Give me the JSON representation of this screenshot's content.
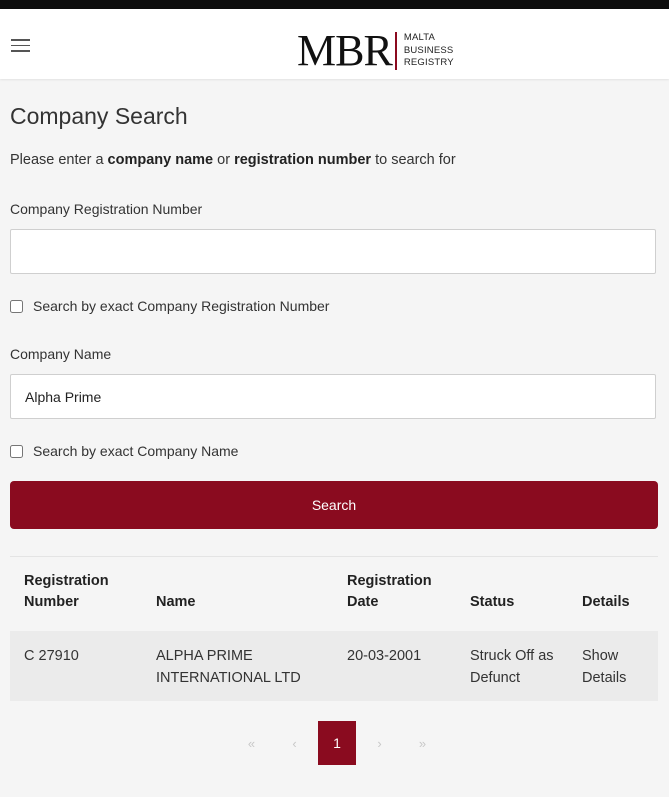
{
  "header": {
    "logo_mark": "MBR",
    "logo_lines": [
      "MALTA",
      "BUSINESS",
      "REGISTRY"
    ]
  },
  "page": {
    "title": "Company Search",
    "intro": {
      "prefix": "Please enter a ",
      "bold1": "company name",
      "middle": " or ",
      "bold2": "registration number",
      "suffix": " to search for"
    }
  },
  "form": {
    "reg_number_label": "Company Registration Number",
    "reg_number_value": "",
    "exact_reg_label": "Search by exact Company Registration Number",
    "company_name_label": "Company Name",
    "company_name_value": "Alpha Prime",
    "exact_name_label": "Search by exact Company Name",
    "search_button": "Search"
  },
  "results": {
    "headers": {
      "reg_line1": "Registration",
      "reg_line2": "Number",
      "name": "Name",
      "date_line1": "Registration",
      "date_line2": "Date",
      "status": "Status",
      "details": "Details"
    },
    "rows": [
      {
        "reg_number": "C 27910",
        "name_line1": "ALPHA PRIME",
        "name_line2": "INTERNATIONAL LTD",
        "date": "20-03-2001",
        "status_line1": "Struck Off as",
        "status_line2": "Defunct",
        "details_line1": "Show",
        "details_line2": "Details"
      }
    ]
  },
  "pagination": {
    "first": "«",
    "prev": "‹",
    "current": "1",
    "next": "›",
    "last": "»"
  },
  "colors": {
    "accent": "#8a0b1f",
    "background": "#f5f5f5"
  }
}
